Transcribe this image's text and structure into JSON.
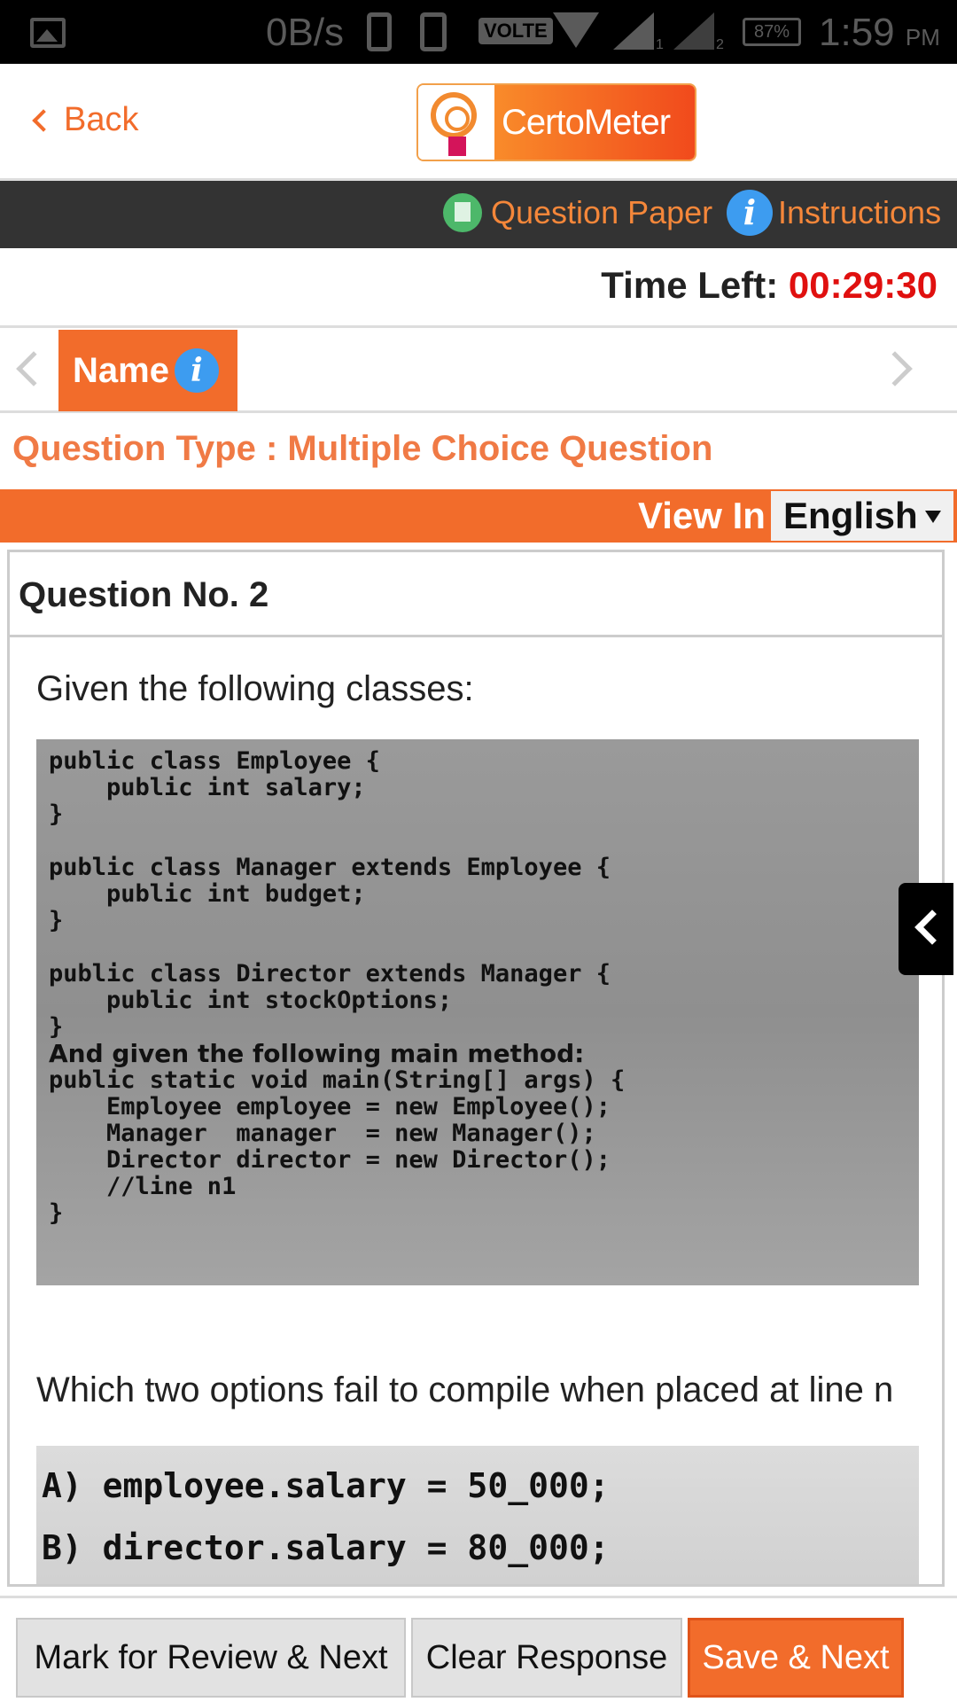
{
  "status_bar": {
    "net_speed": "0B/s",
    "volte": "VOLTE",
    "sim1": "1",
    "sim2": "2",
    "battery": "87%",
    "time": "1:59",
    "ampm": "PM"
  },
  "header": {
    "back_label": "Back",
    "logo_text": "CertoMeter"
  },
  "nav": {
    "question_paper": "Question Paper",
    "instructions": "Instructions",
    "info_glyph": "i"
  },
  "timer": {
    "label": "Time Left: ",
    "value": "00:29:30"
  },
  "section_tab": {
    "label": "Name",
    "info_glyph": "i"
  },
  "question_type": "Question Type : Multiple Choice Question",
  "view_in": {
    "label": "View In",
    "language": "English"
  },
  "question": {
    "number_label": "Question No. 2",
    "intro": "Given the following classes:",
    "code_lines": [
      "public class Employee {",
      "    public int salary;",
      "}",
      "",
      "public class Manager extends Employee {",
      "    public int budget;",
      "}",
      "",
      "public class Director extends Manager {",
      "    public int stockOptions;",
      "}"
    ],
    "code_prose": "And given the following main method:",
    "main_lines": [
      "public static void main(String[] args) {",
      "    Employee employee = new Employee();",
      "    Manager  manager  = new Manager();",
      "    Director director = new Director();",
      "    //line n1",
      "}"
    ],
    "prompt": "Which two options fail to compile when placed at line n",
    "options": [
      "A) employee.salary = 50_000;",
      "B) director.salary = 80_000;"
    ]
  },
  "footer": {
    "mark_review": "Mark for Review & Next",
    "clear_response": "Clear Response",
    "save_next": "Save & Next"
  },
  "colors": {
    "accent": "#f26c2b",
    "timer_red": "#e0100f",
    "nav_dark": "#333333",
    "info_blue": "#3d9cf0"
  }
}
